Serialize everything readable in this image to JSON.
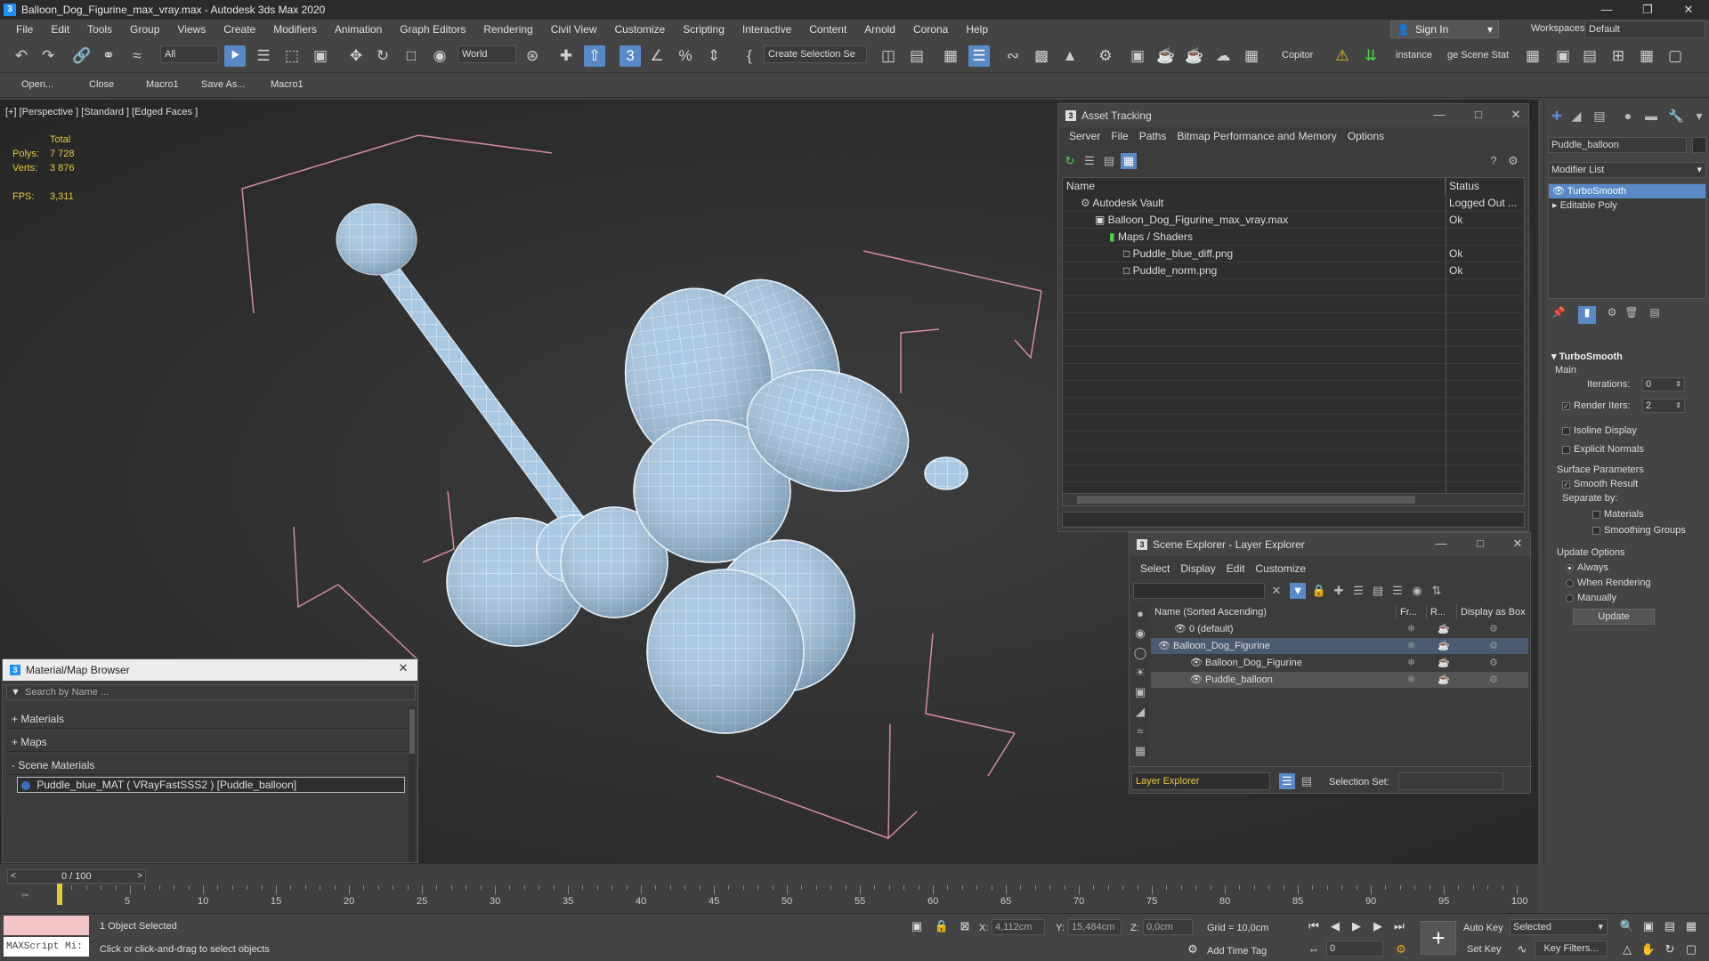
{
  "window": {
    "title": "Balloon_Dog_Figurine_max_vray.max - Autodesk 3ds Max 2020"
  },
  "menu": [
    "File",
    "Edit",
    "Tools",
    "Group",
    "Views",
    "Create",
    "Modifiers",
    "Animation",
    "Graph Editors",
    "Rendering",
    "Civil View",
    "Customize",
    "Scripting",
    "Interactive",
    "Content",
    "Arnold",
    "Corona",
    "Help"
  ],
  "signin": {
    "label": "Sign In"
  },
  "workspace": {
    "label": "Workspaces:",
    "value": "Default"
  },
  "toolbar": {
    "filter": "All",
    "coord": "World",
    "selset": "Create Selection Se",
    "copitor": "Copitor",
    "instance": "instance",
    "scenestat": "ge Scene Stat"
  },
  "macros": [
    "Open...",
    "Close",
    "Macro1",
    "Save As...",
    "Macro1"
  ],
  "viewport": {
    "label": "[+] [Perspective ] [Standard ] [Edged Faces ]",
    "stats": {
      "total": "Total",
      "polys_label": "Polys:",
      "polys": "7 728",
      "verts_label": "Verts:",
      "verts": "3 876",
      "fps_label": "FPS:",
      "fps": "3,311"
    }
  },
  "asset_tracking": {
    "title": "Asset Tracking",
    "menu": [
      "Server",
      "File",
      "Paths",
      "Bitmap Performance and Memory",
      "Options"
    ],
    "columns": [
      "Name",
      "Status"
    ],
    "rows": [
      {
        "name": "Autodesk Vault",
        "status": "Logged Out ...",
        "indent": 0
      },
      {
        "name": "Balloon_Dog_Figurine_max_vray.max",
        "status": "Ok",
        "indent": 1
      },
      {
        "name": "Maps / Shaders",
        "status": "",
        "indent": 2
      },
      {
        "name": "Puddle_blue_diff.png",
        "status": "Ok",
        "indent": 3
      },
      {
        "name": "Puddle_norm.png",
        "status": "Ok",
        "indent": 3
      }
    ]
  },
  "scene_explorer": {
    "title": "Scene Explorer - Layer Explorer",
    "menu": [
      "Select",
      "Display",
      "Edit",
      "Customize"
    ],
    "columns": [
      "Name (Sorted Ascending)",
      "Fr...",
      "R...",
      "Display as Box"
    ],
    "rows": [
      {
        "name": "0 (default)",
        "indent": 1
      },
      {
        "name": "Balloon_Dog_Figurine",
        "indent": 0
      },
      {
        "name": "Balloon_Dog_Figurine",
        "indent": 2
      },
      {
        "name": "Puddle_balloon",
        "indent": 2
      }
    ],
    "footer_explorer": "Layer Explorer",
    "footer_selset": "Selection Set:"
  },
  "material_browser": {
    "title": "Material/Map Browser",
    "search_placeholder": "Search by Name ...",
    "categories": [
      "+ Materials",
      "+ Maps",
      "- Scene Materials"
    ],
    "item": "Puddle_blue_MAT ( VRayFastSSS2 ) [Puddle_balloon]"
  },
  "command_panel": {
    "object_name": "Puddle_balloon",
    "modifier_list": "Modifier List",
    "stack": [
      "TurboSmooth",
      "Editable Poly"
    ],
    "rollout": "TurboSmooth",
    "main": "Main",
    "iterations_label": "Iterations:",
    "iterations": "0",
    "render_iters_label": "Render Iters:",
    "render_iters": "2",
    "isoline": "Isoline Display",
    "explicit": "Explicit Normals",
    "surface": "Surface Parameters",
    "smooth_result": "Smooth Result",
    "separate_by": "Separate by:",
    "materials": "Materials",
    "smoothing_groups": "Smoothing Groups",
    "update_options": "Update Options",
    "always": "Always",
    "when_rendering": "When Rendering",
    "manually": "Manually",
    "update": "Update"
  },
  "timeline": {
    "frame": "0 / 100",
    "ticks": [
      "5",
      "10",
      "15",
      "20",
      "25",
      "30",
      "35",
      "40",
      "45",
      "50",
      "55",
      "60",
      "65",
      "70",
      "75",
      "80",
      "85",
      "90",
      "95",
      "100"
    ]
  },
  "status": {
    "maxscript": "MAXScript Mi:",
    "selected": "1 Object Selected",
    "prompt": "Click or click-and-drag to select objects",
    "x_label": "X:",
    "x": "4,112cm",
    "y_label": "Y:",
    "y": "15,484cm",
    "z_label": "Z:",
    "z": "0,0cm",
    "grid": "Grid = 10,0cm",
    "add_time_tag": "Add Time Tag",
    "auto_key": "Auto Key",
    "set_key": "Set Key",
    "selected_dd": "Selected",
    "key_filters": "Key Filters...",
    "frame_field": "0"
  }
}
